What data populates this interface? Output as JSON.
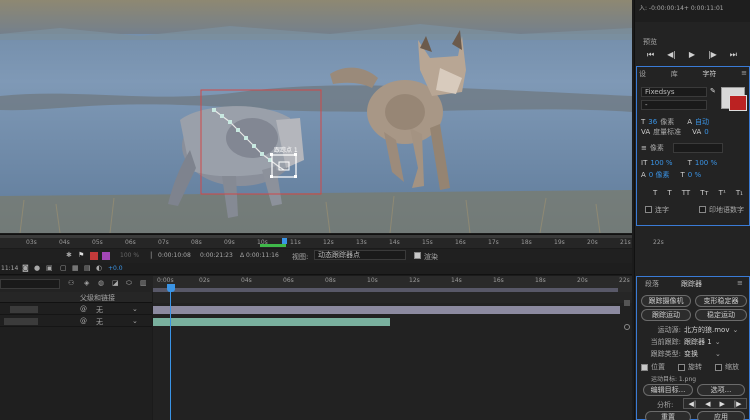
{
  "viewer": {
    "track_point_label": "跟踪点 1"
  },
  "info": {
    "line1": "入: -0:00:00:14+  0:00:11:01"
  },
  "preview": {
    "title": "预览"
  },
  "character": {
    "tabs": [
      "设",
      "库",
      "字符"
    ],
    "font_name": "Fixedsys",
    "font_style": "-",
    "size_value": "36",
    "size_unit": "像素",
    "leading_value": "自动",
    "kerning_value": "度量标准",
    "tracking_value": "0",
    "stroke_unit": "像素",
    "vscale": "100 %",
    "hscale": "100 %",
    "baseline": "0 像素",
    "tsume": "0 %",
    "ligatures_label": "连字",
    "hindi_label": "印地语数字"
  },
  "ruler_top": {
    "labels": [
      "03s",
      "04s",
      "05s",
      "06s",
      "07s",
      "08s",
      "09s",
      "10s",
      "11s",
      "12s",
      "13s",
      "14s",
      "15s",
      "16s",
      "17s",
      "18s",
      "19s",
      "20s",
      "21s",
      "22s"
    ]
  },
  "comp_toolbar": {
    "zoom": "100 %",
    "exposure": "+0.0",
    "time_a": "0:00:10:08",
    "time_b": "0:00:21:23",
    "time_c": "Δ 0:00:11:16",
    "view_label": "视图:",
    "view_value": "动态跟踪器点",
    "render_label": "渲染",
    "time_left": "11:14"
  },
  "timeline": {
    "header_label": "父级和链接",
    "row1_value": "无",
    "row2_value": "无",
    "ruler_labels": [
      "0:00s",
      "02s",
      "04s",
      "06s",
      "08s",
      "10s",
      "12s",
      "14s",
      "16s",
      "18s",
      "20s",
      "22s"
    ]
  },
  "tracker": {
    "tabs": [
      "段落",
      "跟踪器"
    ],
    "btn_camera": "跟踪摄像机",
    "btn_warp": "变形稳定器",
    "btn_motion": "跟踪运动",
    "btn_stabilize": "稳定运动",
    "source_label": "运动源:",
    "source_value": "北方的狼.mov",
    "current_track_label": "当前跟踪:",
    "current_track_value": "跟踪器 1",
    "track_type_label": "跟踪类型:",
    "track_type_value": "变换",
    "position_label": "位置",
    "rotation_label": "旋转",
    "scale_label": "缩放",
    "motion_target": "运动目标: 1.png",
    "edit_target": "编辑目标...",
    "options": "选项...",
    "analyze_label": "分析:",
    "reset": "重置",
    "apply": "应用"
  }
}
